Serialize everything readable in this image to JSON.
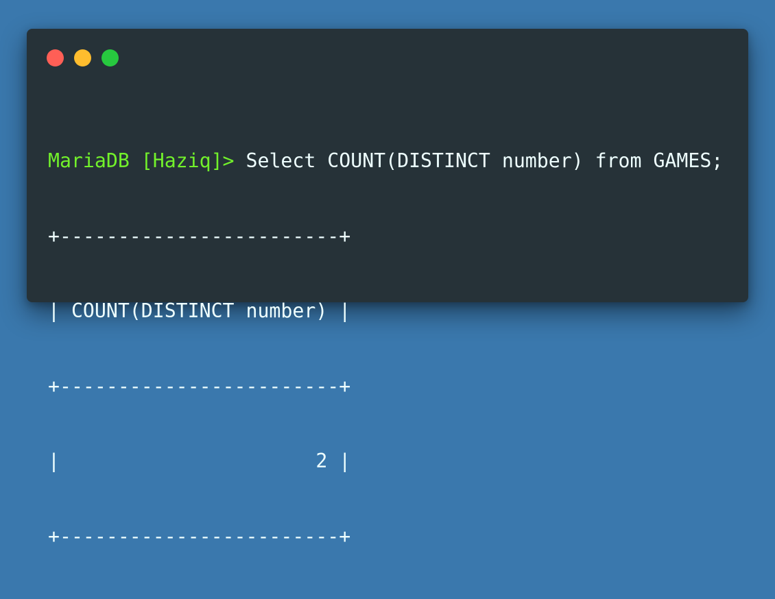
{
  "window": {
    "controls": [
      {
        "name": "close",
        "color": "#ff5f56"
      },
      {
        "name": "minimize",
        "color": "#ffbd2e"
      },
      {
        "name": "maximize",
        "color": "#27c93f"
      }
    ]
  },
  "terminal": {
    "prompt": "MariaDB [Haziq]> ",
    "command": "Select COUNT(DISTINCT number) from GAMES;",
    "output": [
      "+------------------------+",
      "| COUNT(DISTINCT number) |",
      "+------------------------+",
      "|                      2 |",
      "+------------------------+"
    ]
  },
  "colors": {
    "background": "#3a78ad",
    "window": "#263238",
    "prompt": "#72f12b",
    "text": "#eeffff"
  }
}
